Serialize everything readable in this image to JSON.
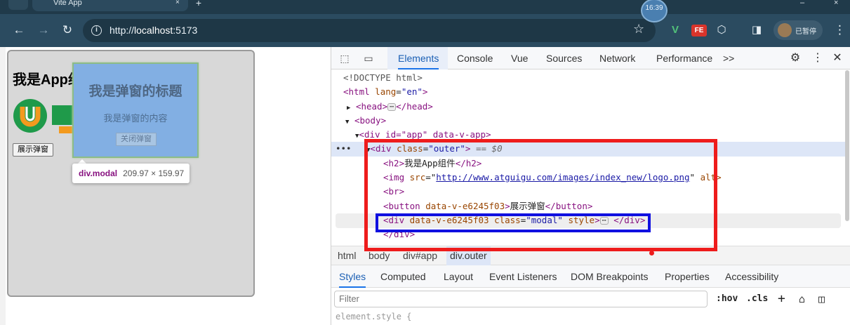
{
  "browser": {
    "tab_title": "Vite App",
    "tab_close": "×",
    "new_tab": "+",
    "clock": "16:39",
    "window_min": "–",
    "window_close": "×",
    "nav": {
      "back": "←",
      "forward": "→",
      "reload": "↻"
    },
    "url_scheme": "http://",
    "url_host": "localhost",
    "url_port": ":5173",
    "extensions": [
      "V",
      "FE"
    ],
    "profile_label": "已暂停"
  },
  "page": {
    "heading": "我是App组件",
    "show_button": "展示弹窗",
    "modal": {
      "title": "我是弹窗的标题",
      "content": "我是弹窗的内容",
      "close_button": "关闭弹窗"
    },
    "tooltip": {
      "tag": "div.modal",
      "size": "209.97 × 159.97"
    }
  },
  "devtools": {
    "tabs": [
      "Elements",
      "Console",
      "Vue",
      "Sources",
      "Network",
      "Performance"
    ],
    "active_tab": "Elements",
    "more_tabs": ">>",
    "dom": {
      "doctype": "<!DOCTYPE html>",
      "html_open": "<html",
      "html_lang_attr": "lang",
      "html_lang_val": "\"en\"",
      "head": "<head>",
      "head_close": "</head>",
      "body": "<body>",
      "app_div_partial": "<div id=\"app\" data-v-app>",
      "outer_div_tag": "<div",
      "outer_attr": "class",
      "outer_val": "\"outer\"",
      "outer_eq": "== $0",
      "h2_open": "<h2>",
      "h2_text": "我是App组件",
      "h2_close": "</h2>",
      "img_tag": "<img",
      "img_attr": "src",
      "img_src": "http://www.atguigu.com/images/index_new/logo.png",
      "img_alt": "alt>",
      "br": "<br>",
      "button_tag": "<button",
      "button_attr": "data-v-e6245f03",
      "button_text": "展示弹窗",
      "button_close": "</button>",
      "modal_tag": "<div",
      "modal_attr1": "data-v-e6245f03",
      "modal_attr2": "class",
      "modal_val": "\"modal\"",
      "modal_attr3": "style",
      "modal_close": "</div>",
      "outer_close": "</div>",
      "row_dots": "•••",
      "ellipsis": "⋯"
    },
    "breadcrumbs": [
      "html",
      "body",
      "div#app",
      "div.outer"
    ],
    "styles_tabs": [
      "Styles",
      "Computed",
      "Layout",
      "Event Listeners",
      "DOM Breakpoints",
      "Properties",
      "Accessibility"
    ],
    "active_styles_tab": "Styles",
    "filter_placeholder": "Filter",
    "hov": ":hov",
    "cls": ".cls",
    "element_style_peek": "element.style {"
  },
  "colors": {
    "annotation_red": "#ee1c1c",
    "annotation_blue": "#1010e0",
    "modal_bg": "#82afe3",
    "chrome_bg": "#2b4b60"
  }
}
